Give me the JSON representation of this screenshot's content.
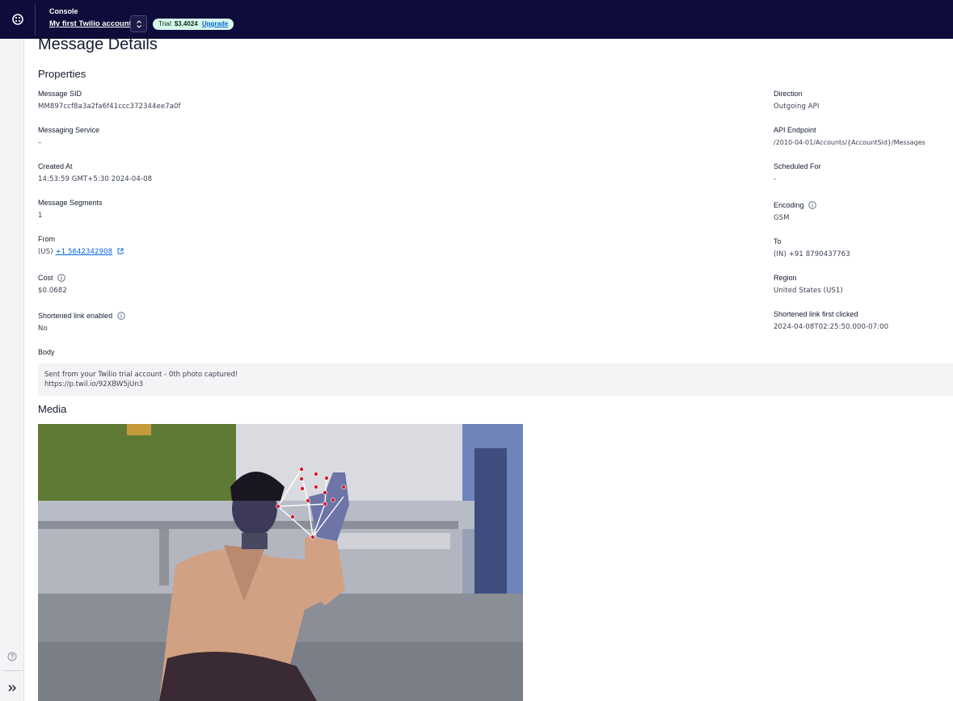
{
  "header": {
    "console_label": "Console",
    "account_name": "My first Twilio account",
    "trial_prefix": "Trial:",
    "trial_amount": "$3.4024",
    "upgrade_label": "Upgrade"
  },
  "page": {
    "title": "Message Details",
    "properties_heading": "Properties",
    "body_heading": "Body",
    "media_heading": "Media"
  },
  "left_properties": [
    {
      "label": "Message SID",
      "value": "MM897ccf8a3a2fa6f41ccc372344ee7a0f"
    },
    {
      "label": "Messaging Service",
      "value": "–"
    },
    {
      "label": "Created At",
      "value": "14:53:59 GMT+5:30 2024-04-08"
    },
    {
      "label": "Message Segments",
      "value": "1"
    },
    {
      "label": "From",
      "value_prefix": "(US)",
      "value_link": "+1 5642342908"
    },
    {
      "label": "Cost",
      "value": "$0.0682"
    },
    {
      "label": "Shortened link enabled",
      "value": "No"
    }
  ],
  "right_properties": [
    {
      "label": "Direction",
      "value": "Outgoing API"
    },
    {
      "label": "API Endpoint",
      "value": "/2010-04-01/Accounts/{AccountSid}/Messages"
    },
    {
      "label": "Scheduled For",
      "value": "-"
    },
    {
      "label": "Encoding",
      "value": "GSM"
    },
    {
      "label": "To",
      "value": "(IN) +91 8790437763"
    },
    {
      "label": "Region",
      "value": "United States (US1)"
    },
    {
      "label": "Shortened link first clicked",
      "value": "2024-04-08T02:25:50.000-07:00"
    }
  ],
  "body": {
    "line1": "Sent from your Twilio trial account - 0th photo captured!",
    "line2": "https://p.twil.io/92XBW5jUn3"
  },
  "colors": {
    "topbar": "#0d0c3a",
    "link": "#0263e0",
    "trial_pill": "#d8f8ec"
  }
}
